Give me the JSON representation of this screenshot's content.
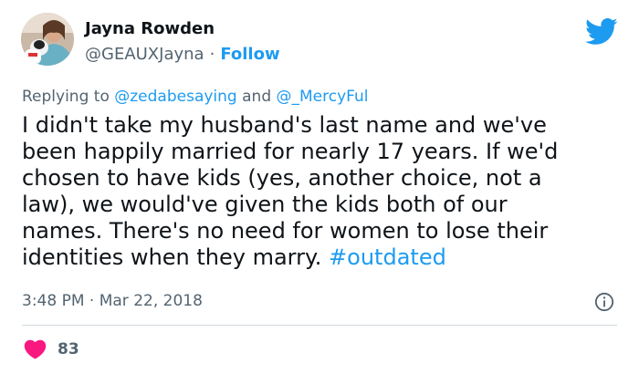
{
  "author": {
    "name": "Jayna Rowden",
    "handle": "@GEAUXJayna",
    "separator": "·",
    "follow_label": "Follow"
  },
  "reply_context": {
    "prefix": "Replying to ",
    "mention_1": "@zedabesaying",
    "joiner": " and ",
    "mention_2": "@_MercyFul"
  },
  "tweet": {
    "lines": [
      "I didn't take my husband's last name and we've",
      "been happily married for nearly 17 years. If we'd",
      "chosen to have kids (yes, another choice, not a",
      "law), we would've given the kids both of our",
      "names. There's no need for women to lose their",
      "identities when they marry. "
    ],
    "hashtag": "#outdated"
  },
  "meta": {
    "time": "3:48 PM",
    "separator": "·",
    "date": "Mar 22, 2018"
  },
  "engagement": {
    "likes": "83"
  },
  "icons": {
    "brand": "twitter-bird-icon",
    "info": "info-icon",
    "like": "heart-icon"
  },
  "colors": {
    "accent": "#1d9bf0",
    "like": "#f91880",
    "muted": "#536471",
    "text": "#0f1419"
  }
}
